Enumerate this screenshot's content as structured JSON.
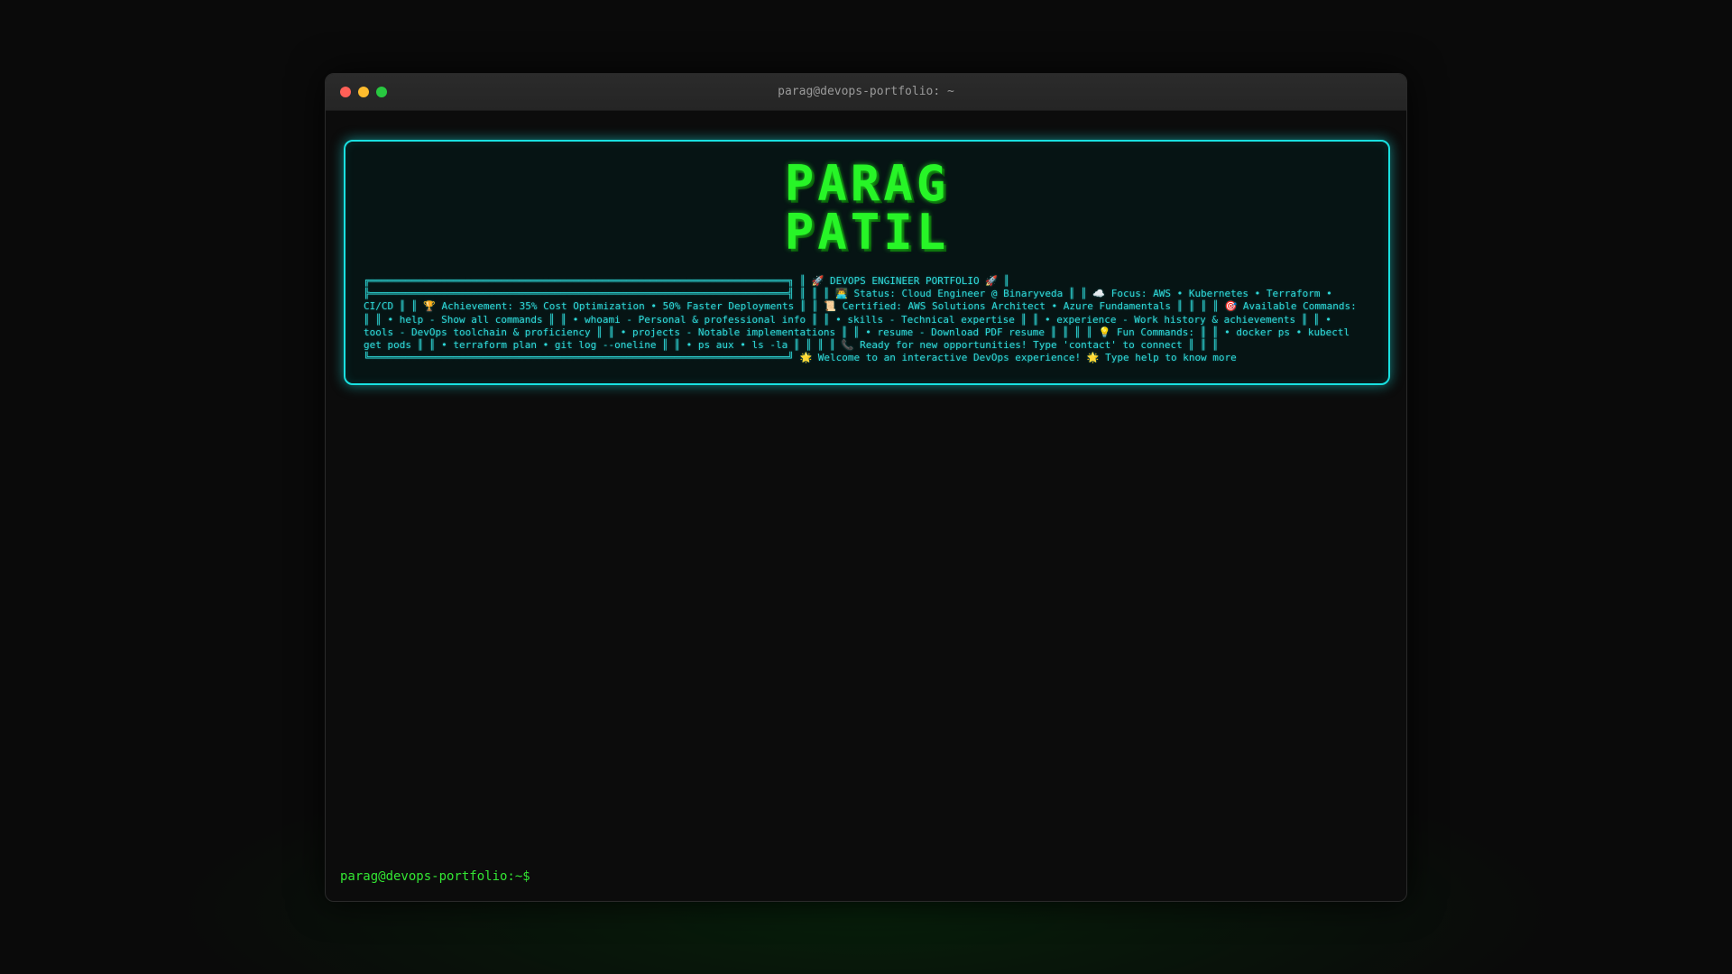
{
  "window": {
    "title": "parag@devops-portfolio: ~",
    "controls": {
      "close_color": "#ff5f57",
      "minimize_color": "#febc2e",
      "maximize_color": "#28c840"
    }
  },
  "banner": {
    "name_line_1": "PARAG",
    "name_line_2": "PATIL",
    "ascii_text": "╔══════════════════════════════════════════════════════════════════════╗ ║ 🚀 DEVOPS ENGINEER PORTFOLIO 🚀 ║ ╠══════════════════════════════════════════════════════════════════════╣ ║ ║ ║ 👨‍💻 Status: Cloud Engineer @ Binaryveda ║ ║ ☁️ Focus: AWS • Kubernetes • Terraform • CI/CD ║ ║ 🏆 Achievement: 35% Cost Optimization • 50% Faster Deployments ║ ║ 📜 Certified: AWS Solutions Architect • Azure Fundamentals ║ ║ ║ ║ 🎯 Available Commands: ║ ║ • help - Show all commands ║ ║ • whoami - Personal & professional info ║ ║ • skills - Technical expertise ║ ║ • experience - Work history & achievements ║ ║ • tools - DevOps toolchain & proficiency ║ ║ • projects - Notable implementations ║ ║ • resume - Download PDF resume ║ ║ ║ ║ 💡 Fun Commands: ║ ║ • docker ps • kubectl get pods ║ ║ • terraform plan • git log --oneline ║ ║ • ps aux • ls -la ║ ║ ║ ║ 📞 Ready for new opportunities! Type 'contact' to connect ║ ║ ║ ╚══════════════════════════════════════════════════════════════════════╝ 🌟 Welcome to an interactive DevOps experience! 🌟 Type help to know more"
  },
  "prompt": {
    "text": "parag@devops-portfolio:~$",
    "value": ""
  },
  "colors": {
    "accent_cyan": "#19e0e0",
    "terminal_green": "#33e633",
    "name_green": "#27f527"
  }
}
